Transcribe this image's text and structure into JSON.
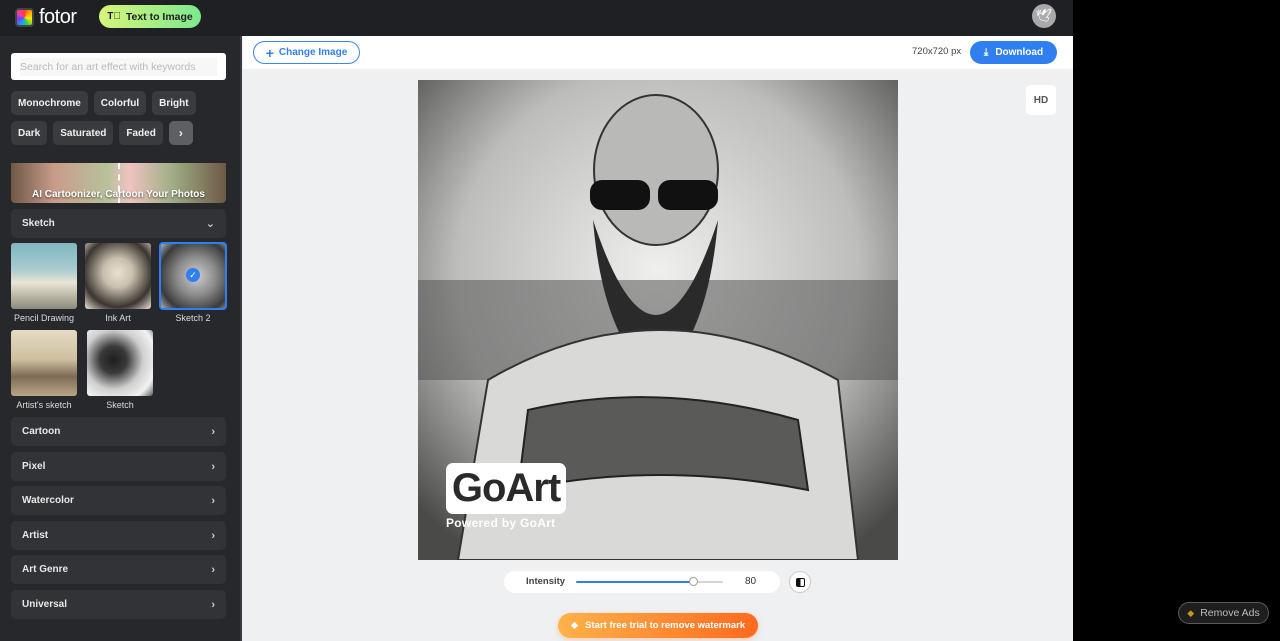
{
  "topbar": {
    "logo_text": "fotor",
    "text_to_image_label": "Text to Image",
    "text_to_image_icon": "text-image-icon",
    "avatar_icon": "bird-icon"
  },
  "sidebar": {
    "search": {
      "placeholder": "Search for an art effect with keywords",
      "value": ""
    },
    "chips_row1": [
      "Monochrome",
      "Colorful",
      "Bright"
    ],
    "chips_row2": [
      "Dark",
      "Saturated",
      "Faded"
    ],
    "chips_more_icon": "chevron-right-icon",
    "banner_text": "AI Cartoonizer, Cartoon Your Photos",
    "expanded_section": {
      "label": "Sketch",
      "icon": "chevron-down-icon"
    },
    "effects": [
      {
        "label": "Pencil Drawing",
        "selected": false
      },
      {
        "label": "Ink Art",
        "selected": false
      },
      {
        "label": "Sketch 2",
        "selected": true
      },
      {
        "label": "Artist's sketch",
        "selected": false
      },
      {
        "label": "Sketch",
        "selected": false
      }
    ],
    "sections": [
      {
        "label": "Cartoon"
      },
      {
        "label": "Pixel"
      },
      {
        "label": "Watercolor"
      },
      {
        "label": "Artist"
      },
      {
        "label": "Art Genre"
      },
      {
        "label": "Universal"
      }
    ]
  },
  "toolbar": {
    "change_image_label": "Change Image",
    "dimensions": "720x720 px",
    "download_label": "Download",
    "hd_label": "HD"
  },
  "canvas": {
    "watermark_logo": "GoArt",
    "watermark_sub": "Powered by GoArt"
  },
  "intensity": {
    "label": "Intensity",
    "value": 80,
    "value_text": "80",
    "min": 0,
    "max": 100
  },
  "trial_button_label": "Start free trial to remove watermark",
  "remove_ads_label": "Remove Ads",
  "colors": {
    "accent": "#2f7ff0",
    "sidebar_bg": "#27282c",
    "trial_gradient_start": "#ffb24a",
    "trial_gradient_end": "#ff6a1f"
  }
}
